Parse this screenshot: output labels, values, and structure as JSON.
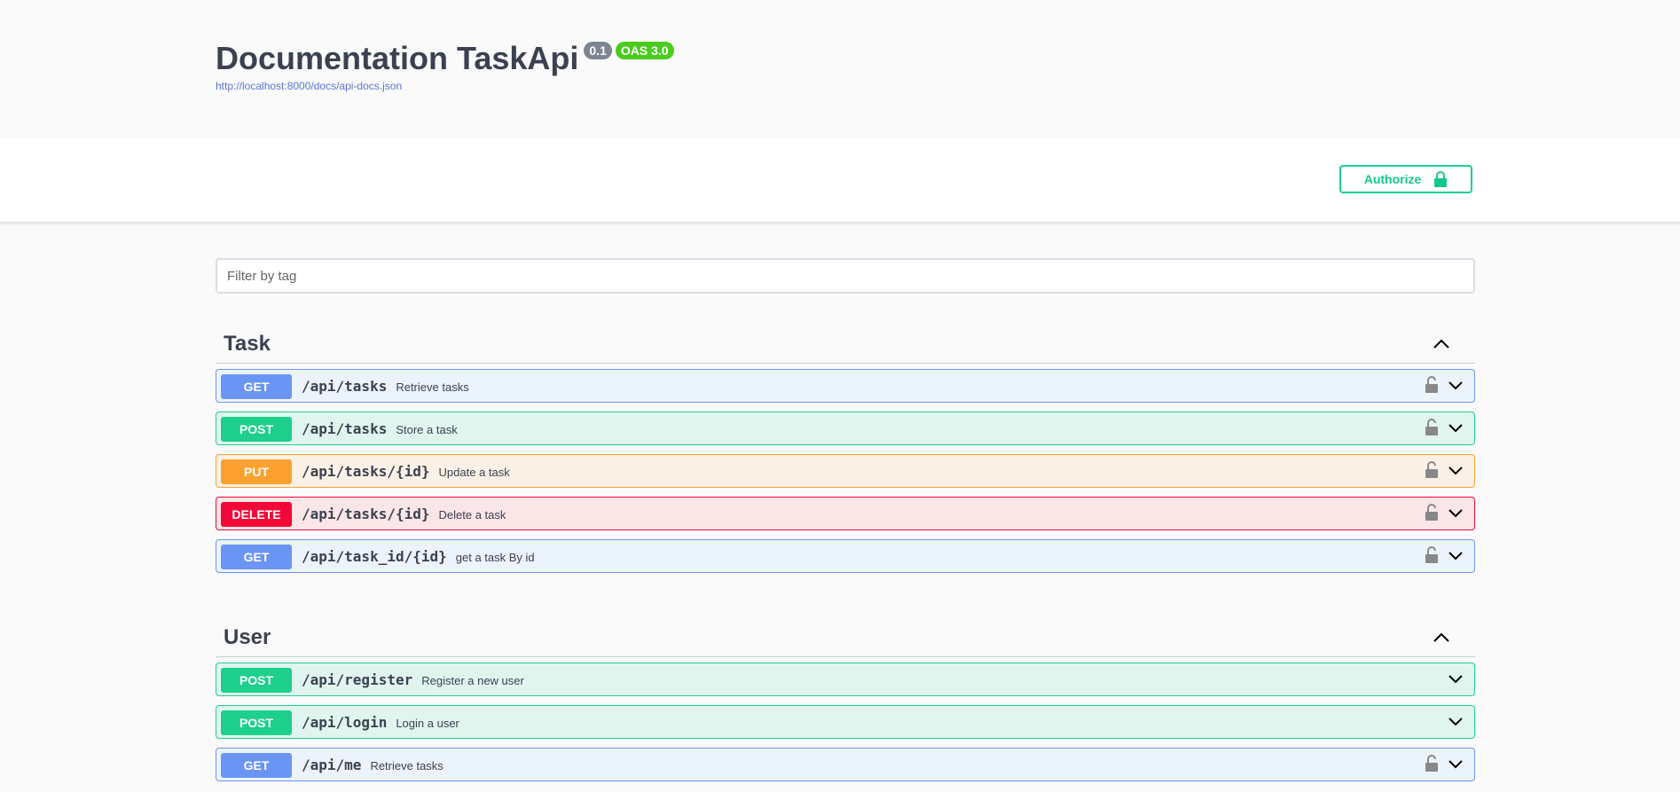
{
  "info": {
    "title": "Documentation TaskApi",
    "version": "0.1",
    "oas": "OAS 3.0",
    "spec_url": "http://localhost:8000/docs/api-docs.json"
  },
  "scheme": {
    "authorize_label": "Authorize"
  },
  "filter": {
    "placeholder": "Filter by tag"
  },
  "tags": [
    {
      "name": "Task",
      "operations": [
        {
          "method": "GET",
          "path": "/api/tasks",
          "summary": "Retrieve tasks",
          "locked": true
        },
        {
          "method": "POST",
          "path": "/api/tasks",
          "summary": "Store a task",
          "locked": true
        },
        {
          "method": "PUT",
          "path": "/api/tasks/{id}",
          "summary": "Update a task",
          "locked": true
        },
        {
          "method": "DELETE",
          "path": "/api/tasks/{id}",
          "summary": "Delete a task",
          "locked": true
        },
        {
          "method": "GET",
          "path": "/api/task_id/{id}",
          "summary": "get a task By id",
          "locked": true
        }
      ]
    },
    {
      "name": "User",
      "operations": [
        {
          "method": "POST",
          "path": "/api/register",
          "summary": "Register a new user",
          "locked": false
        },
        {
          "method": "POST",
          "path": "/api/login",
          "summary": "Login a user",
          "locked": false
        },
        {
          "method": "GET",
          "path": "/api/me",
          "summary": "Retrieve tasks",
          "locked": true
        }
      ]
    }
  ],
  "colors": {
    "get": "#6b95f5",
    "post": "#1dd08c",
    "put": "#fca130",
    "delete": "#f20838",
    "authorize": "#1dd08c"
  },
  "icons": {
    "authorize": "lock-icon",
    "operation_lock": "unlocked-icon",
    "tag_toggle": "chevron-up-icon",
    "op_toggle": "chevron-down-icon"
  }
}
